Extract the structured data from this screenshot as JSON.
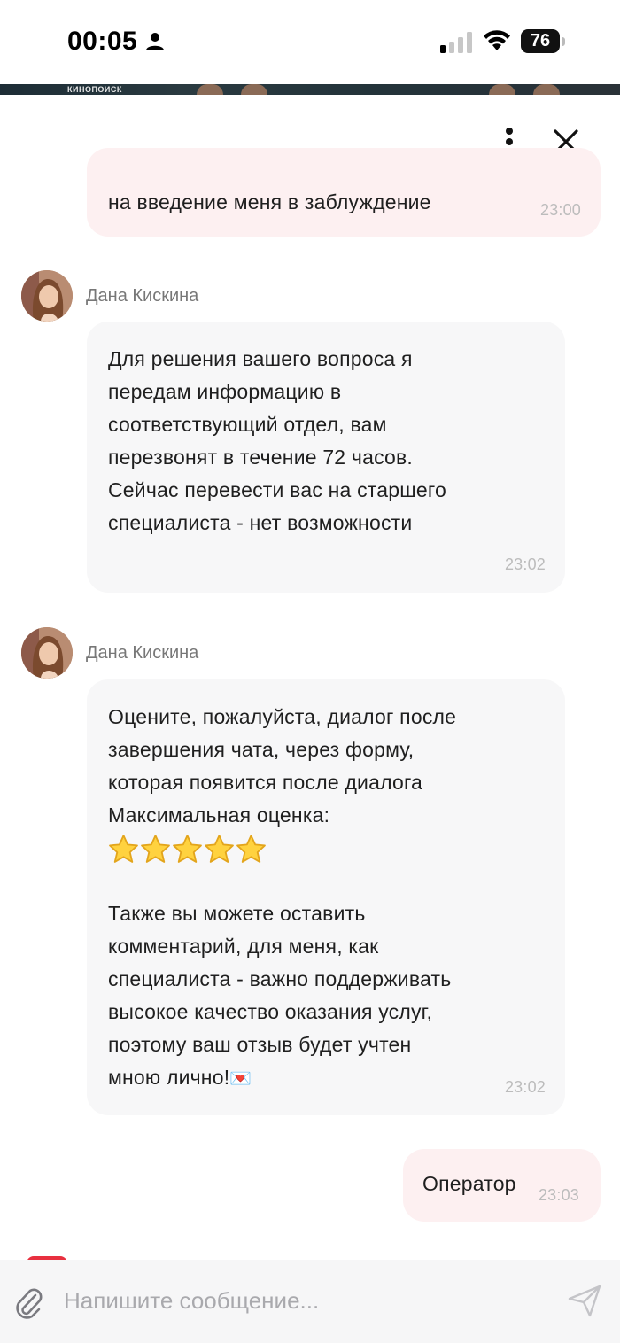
{
  "status_bar": {
    "time": "00:05",
    "battery": "76"
  },
  "banner": {
    "text": "КИНОПОИСК"
  },
  "header": {
    "more_icon": "more-vertical-icon",
    "close_icon": "close-icon"
  },
  "messages": [
    {
      "direction": "out",
      "text": "на введение меня в заблуждение",
      "time": "23:00"
    },
    {
      "direction": "in",
      "sender": "Дана Кискина",
      "text": "Для решения вашего вопроса я\nпередам информацию в\nсоответствующий отдел, вам\nперезвонят в течение 72 часов.\nСейчас перевести вас на старшего\nспециалиста - нет возможности",
      "time": "23:02"
    },
    {
      "direction": "in",
      "sender": "Дана Кискина",
      "text_before": "Оцените, пожалуйста, диалог после\nзавершения чата, через форму,\nкоторая появится после диалога\nМаксимальная оценка:",
      "stars": 5,
      "text_after": "Также вы можете оставить\nкомментарий, для меня, как\nспециалиста - важно поддерживать\nвысокое качество оказания услуг,\nпоэтому ваш отзыв будет учтен\nмною лично!",
      "emoji": "💌",
      "time": "23:02"
    },
    {
      "direction": "out",
      "text": "Оператор",
      "time": "23:03"
    }
  ],
  "composer": {
    "placeholder": "Напишите сообщение...",
    "value": ""
  },
  "colors": {
    "outgoing_bubble": "#fdf0f1",
    "incoming_bubble": "#f7f7f8",
    "accent_red": "#e8303f"
  }
}
